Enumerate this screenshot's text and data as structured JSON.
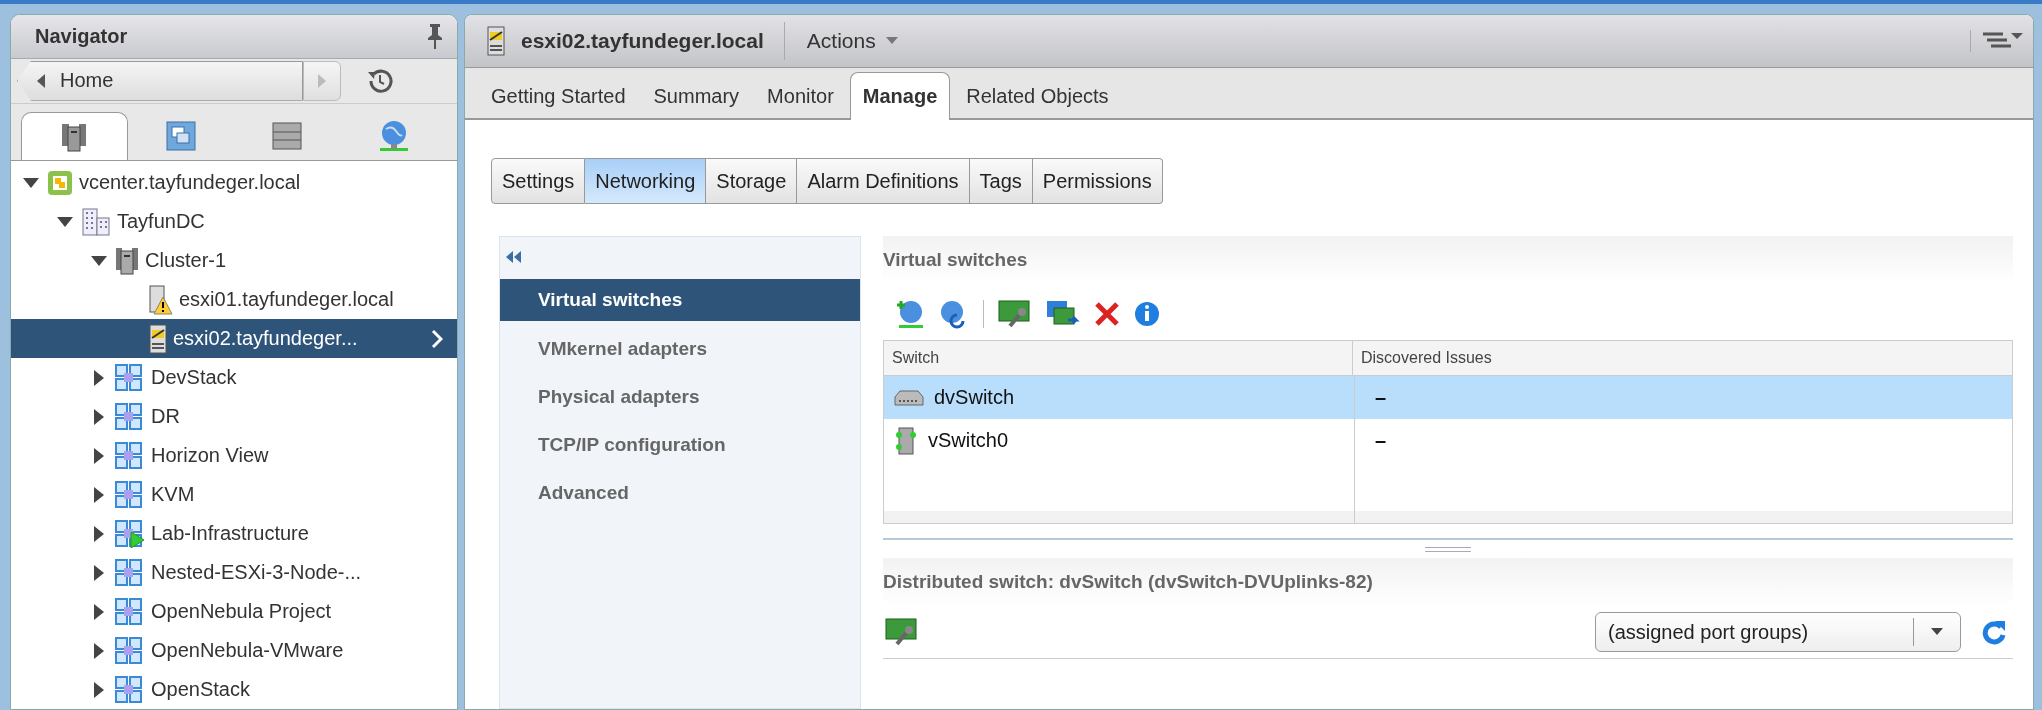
{
  "navigator": {
    "title": "Navigator",
    "history": {
      "label": "Home"
    },
    "tabs": [
      {
        "kind": "hosts",
        "selected": true
      },
      {
        "kind": "vms",
        "selected": false
      },
      {
        "kind": "storage",
        "selected": false
      },
      {
        "kind": "network",
        "selected": false
      }
    ],
    "tree": [
      {
        "label": "vcenter.tayfundeger.local",
        "kind": "vcenter",
        "expanded": true,
        "selected": false,
        "children": [
          {
            "label": "TayfunDC",
            "kind": "datacenter",
            "expanded": true,
            "selected": false,
            "children": [
              {
                "label": "Cluster-1",
                "kind": "cluster",
                "expanded": true,
                "selected": false,
                "children": [
                  {
                    "label": "esxi01.tayfundeger.local",
                    "kind": "host-warning",
                    "selected": false
                  },
                  {
                    "label": "esxi02.tayfundeger...",
                    "kind": "host-maintenance",
                    "selected": true
                  }
                ]
              },
              {
                "label": "DevStack",
                "kind": "vapp",
                "expanded": false,
                "selected": false
              },
              {
                "label": "DR",
                "kind": "vapp",
                "expanded": false,
                "selected": false
              },
              {
                "label": "Horizon View",
                "kind": "vapp",
                "expanded": false,
                "selected": false
              },
              {
                "label": "KVM",
                "kind": "vapp",
                "expanded": false,
                "selected": false
              },
              {
                "label": "Lab-Infrastructure",
                "kind": "vapp-running",
                "expanded": false,
                "selected": false
              },
              {
                "label": "Nested-ESXi-3-Node-...",
                "kind": "vapp",
                "expanded": false,
                "selected": false
              },
              {
                "label": "OpenNebula Project",
                "kind": "vapp",
                "expanded": false,
                "selected": false
              },
              {
                "label": "OpenNebula-VMware",
                "kind": "vapp",
                "expanded": false,
                "selected": false
              },
              {
                "label": "OpenStack",
                "kind": "vapp",
                "expanded": false,
                "selected": false
              }
            ]
          }
        ]
      }
    ]
  },
  "object": {
    "title": "esxi02.tayfundeger.local",
    "actions": "Actions"
  },
  "tabs": [
    {
      "label": "Getting Started",
      "selected": false
    },
    {
      "label": "Summary",
      "selected": false
    },
    {
      "label": "Monitor",
      "selected": false
    },
    {
      "label": "Manage",
      "selected": true
    },
    {
      "label": "Related Objects",
      "selected": false
    }
  ],
  "subtabs": [
    {
      "label": "Settings",
      "selected": false
    },
    {
      "label": "Networking",
      "selected": true
    },
    {
      "label": "Storage",
      "selected": false
    },
    {
      "label": "Alarm Definitions",
      "selected": false
    },
    {
      "label": "Tags",
      "selected": false
    },
    {
      "label": "Permissions",
      "selected": false
    }
  ],
  "side_nav": [
    {
      "label": "Virtual switches",
      "selected": true
    },
    {
      "label": "VMkernel adapters",
      "selected": false
    },
    {
      "label": "Physical adapters",
      "selected": false
    },
    {
      "label": "TCP/IP configuration",
      "selected": false
    },
    {
      "label": "Advanced",
      "selected": false
    }
  ],
  "virtual_switches": {
    "title": "Virtual switches",
    "columns": [
      "Switch",
      "Discovered Issues"
    ],
    "rows": [
      {
        "name": "dvSwitch",
        "issues": "–",
        "kind": "distributed",
        "selected": true
      },
      {
        "name": "vSwitch0",
        "issues": "–",
        "kind": "standard",
        "selected": false
      }
    ]
  },
  "distributed_switch": {
    "title": "Distributed switch: dvSwitch (dvSwitch-DVUplinks-82)",
    "filter": "(assigned port groups)"
  }
}
